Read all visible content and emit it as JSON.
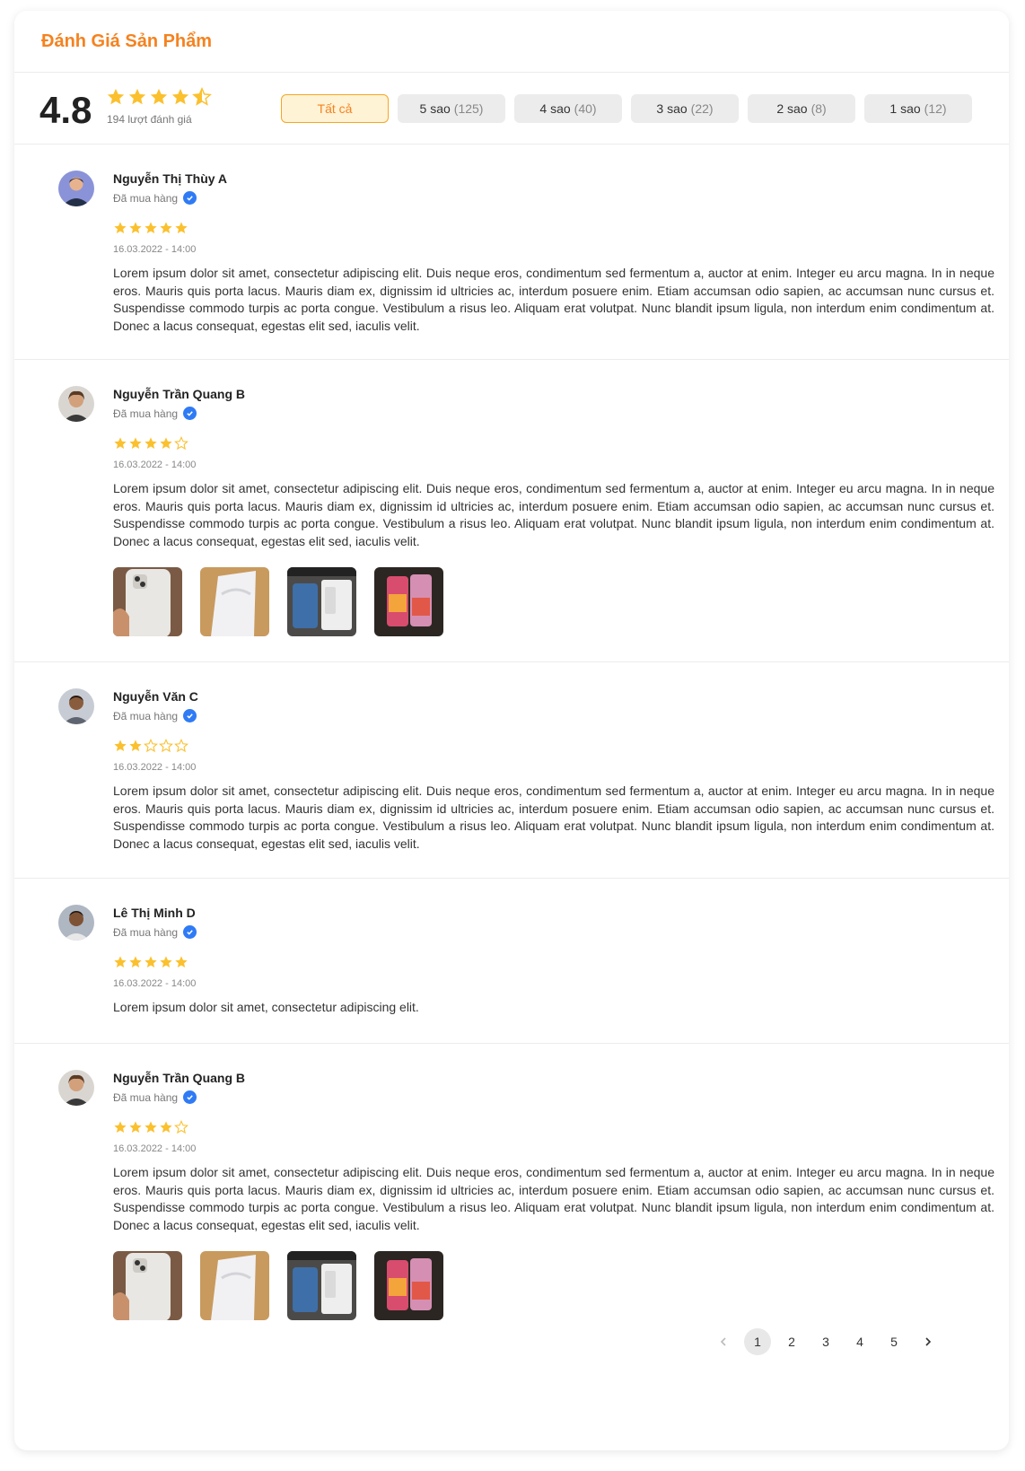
{
  "header": {
    "title": "Đánh Giá Sản Phẩm"
  },
  "summary": {
    "average": "4.8",
    "rating_value": 4.5,
    "count_label": "194 lượt đánh giá"
  },
  "filters": [
    {
      "label": "Tất cả",
      "count": "",
      "active": true
    },
    {
      "label": "5 sao",
      "count": "(125)",
      "active": false
    },
    {
      "label": "4 sao",
      "count": "(40)",
      "active": false
    },
    {
      "label": "3 sao",
      "count": "(22)",
      "active": false
    },
    {
      "label": "2 sao",
      "count": "(8)",
      "active": false
    },
    {
      "label": "1 sao",
      "count": "(12)",
      "active": false
    }
  ],
  "reviews": [
    {
      "name": "Nguyễn Thị Thùy A",
      "bought_label": "Đã mua hàng",
      "rating": 5,
      "date": "16.03.2022 - 14:00",
      "text": "Lorem ipsum dolor sit amet, consectetur adipiscing elit. Duis neque eros, condimentum sed fermentum a, auctor at enim. Integer eu arcu magna. In in neque eros. Mauris quis porta lacus. Mauris diam ex, dignissim id ultricies ac, interdum posuere enim. Etiam accumsan odio sapien, ac accumsan nunc cursus et. Suspendisse commodo turpis ac porta congue. Vestibulum a risus leo. Aliquam erat volutpat. Nunc blandit ipsum ligula, non interdum enim condimentum at. Donec a lacus consequat, egestas elit sed, iaculis velit.",
      "has_images": false
    },
    {
      "name": "Nguyễn Trần Quang B",
      "bought_label": "Đã mua hàng",
      "rating": 4,
      "date": "16.03.2022 - 14:00",
      "text": "Lorem ipsum dolor sit amet, consectetur adipiscing elit. Duis neque eros, condimentum sed fermentum a, auctor at enim. Integer eu arcu magna. In in neque eros. Mauris quis porta lacus. Mauris diam ex, dignissim id ultricies ac, interdum posuere enim. Etiam accumsan odio sapien, ac accumsan nunc cursus et. Suspendisse commodo turpis ac porta congue. Vestibulum a risus leo. Aliquam erat volutpat. Nunc blandit ipsum ligula, non interdum enim condimentum at. Donec a lacus consequat, egestas elit sed, iaculis velit.",
      "has_images": true
    },
    {
      "name": "Nguyễn Văn C",
      "bought_label": "Đã mua hàng",
      "rating": 2,
      "date": "16.03.2022 - 14:00",
      "text": "Lorem ipsum dolor sit amet, consectetur adipiscing elit. Duis neque eros, condimentum sed fermentum a, auctor at enim. Integer eu arcu magna. In in neque eros. Mauris quis porta lacus. Mauris diam ex, dignissim id ultricies ac, interdum posuere enim. Etiam accumsan odio sapien, ac accumsan nunc cursus et. Suspendisse commodo turpis ac porta congue. Vestibulum a risus leo. Aliquam erat volutpat. Nunc blandit ipsum ligula, non interdum enim condimentum at. Donec a lacus consequat, egestas elit sed, iaculis velit.",
      "has_images": false
    },
    {
      "name": "Lê Thị Minh D",
      "bought_label": "Đã mua hàng",
      "rating": 5,
      "date": "16.03.2022 - 14:00",
      "text": "Lorem ipsum dolor sit amet, consectetur adipiscing elit.",
      "has_images": false
    },
    {
      "name": "Nguyễn Trần Quang B",
      "bought_label": "Đã mua hàng",
      "rating": 4,
      "date": "16.03.2022 - 14:00",
      "text": "Lorem ipsum dolor sit amet, consectetur adipiscing elit. Duis neque eros, condimentum sed fermentum a, auctor at enim. Integer eu arcu magna. In in neque eros. Mauris quis porta lacus. Mauris diam ex, dignissim id ultricies ac, interdum posuere enim. Etiam accumsan odio sapien, ac accumsan nunc cursus et. Suspendisse commodo turpis ac porta congue. Vestibulum a risus leo. Aliquam erat volutpat. Nunc blandit ipsum ligula, non interdum enim condimentum at. Donec a lacus consequat, egestas elit sed, iaculis velit.",
      "has_images": true
    }
  ],
  "pagination": {
    "prev_icon": "chevron-left-icon",
    "next_icon": "chevron-right-icon",
    "pages": [
      "1",
      "2",
      "3",
      "4",
      "5"
    ],
    "current": "1"
  },
  "colors": {
    "accent": "#F5821F",
    "star": "#FBC02D",
    "verified": "#2F7BF5",
    "active_filter_bg": "#FFF3D6",
    "filter_bg": "#ECECEC"
  }
}
